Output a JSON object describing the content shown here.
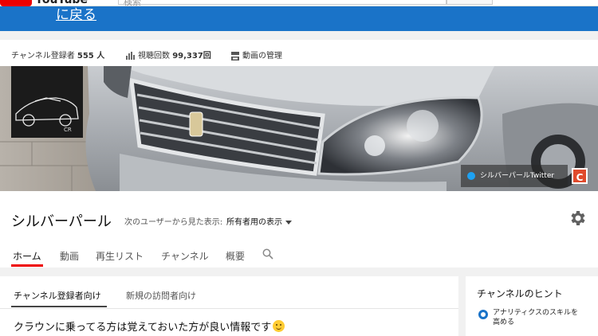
{
  "header": {
    "logo_text": "YouTube",
    "search_placeholder": "検索"
  },
  "banner": {
    "back_link": "に戻る",
    "color": "#1a73c8"
  },
  "stats": {
    "subscribers_label": "チャンネル登録者",
    "subscribers_value": "555 人",
    "views_label": "視聴回数",
    "views_value": "99,337回",
    "manage_label": "動画の管理"
  },
  "cover": {
    "social_link": "シルバーパールTwitter",
    "badge": "C"
  },
  "channel": {
    "name": "シルバーパール",
    "view_as_label": "次のユーザーから見た表示:",
    "view_as_value": "所有者用の表示"
  },
  "tabs": [
    {
      "label": "ホーム",
      "active": true
    },
    {
      "label": "動画"
    },
    {
      "label": "再生リスト"
    },
    {
      "label": "チャンネル"
    },
    {
      "label": "概要"
    }
  ],
  "main": {
    "subtabs": [
      {
        "label": "チャンネル登録者向け",
        "active": true
      },
      {
        "label": "新規の訪問者向け"
      }
    ],
    "headline": "クラウンに乗ってる方は覚えておいた方が良い情報です"
  },
  "hints": {
    "title": "チャンネルのヒント",
    "item_text": "アナリティクスのスキルを高める"
  },
  "colors": {
    "accent_red": "#ee0000",
    "brand_blue": "#1a73c8"
  }
}
